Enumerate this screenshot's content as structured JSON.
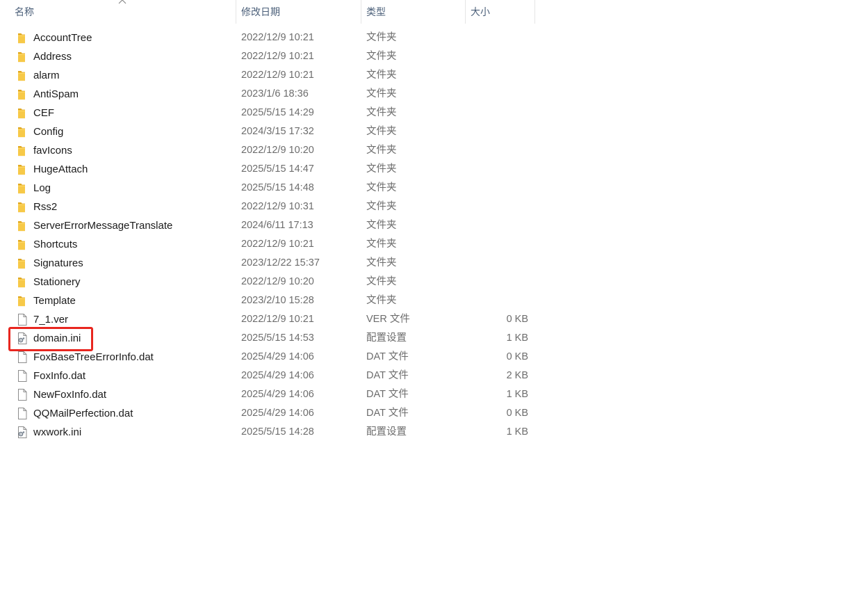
{
  "columns": {
    "name": "名称",
    "date": "修改日期",
    "type": "类型",
    "size": "大小"
  },
  "sort": {
    "column": "name",
    "direction": "ascending",
    "indicator_icon": "chevron-up-icon"
  },
  "colors": {
    "header_text": "#4c607a",
    "folder_yellow": "#f7c948",
    "highlight_red": "#e8261f"
  },
  "files": [
    {
      "name": "AccountTree",
      "date": "2022/12/9 10:21",
      "type": "文件夹",
      "size": "",
      "icon": "folder-icon"
    },
    {
      "name": "Address",
      "date": "2022/12/9 10:21",
      "type": "文件夹",
      "size": "",
      "icon": "folder-icon"
    },
    {
      "name": "alarm",
      "date": "2022/12/9 10:21",
      "type": "文件夹",
      "size": "",
      "icon": "folder-icon"
    },
    {
      "name": "AntiSpam",
      "date": "2023/1/6 18:36",
      "type": "文件夹",
      "size": "",
      "icon": "folder-icon"
    },
    {
      "name": "CEF",
      "date": "2025/5/15 14:29",
      "type": "文件夹",
      "size": "",
      "icon": "folder-icon"
    },
    {
      "name": "Config",
      "date": "2024/3/15 17:32",
      "type": "文件夹",
      "size": "",
      "icon": "folder-icon"
    },
    {
      "name": "favIcons",
      "date": "2022/12/9 10:20",
      "type": "文件夹",
      "size": "",
      "icon": "folder-icon"
    },
    {
      "name": "HugeAttach",
      "date": "2025/5/15 14:47",
      "type": "文件夹",
      "size": "",
      "icon": "folder-icon"
    },
    {
      "name": "Log",
      "date": "2025/5/15 14:48",
      "type": "文件夹",
      "size": "",
      "icon": "folder-icon"
    },
    {
      "name": "Rss2",
      "date": "2022/12/9 10:31",
      "type": "文件夹",
      "size": "",
      "icon": "folder-icon"
    },
    {
      "name": "ServerErrorMessageTranslate",
      "date": "2024/6/11 17:13",
      "type": "文件夹",
      "size": "",
      "icon": "folder-icon"
    },
    {
      "name": "Shortcuts",
      "date": "2022/12/9 10:21",
      "type": "文件夹",
      "size": "",
      "icon": "folder-icon"
    },
    {
      "name": "Signatures",
      "date": "2023/12/22 15:37",
      "type": "文件夹",
      "size": "",
      "icon": "folder-icon"
    },
    {
      "name": "Stationery",
      "date": "2022/12/9 10:20",
      "type": "文件夹",
      "size": "",
      "icon": "folder-icon"
    },
    {
      "name": "Template",
      "date": "2023/2/10 15:28",
      "type": "文件夹",
      "size": "",
      "icon": "folder-icon"
    },
    {
      "name": "7_1.ver",
      "date": "2022/12/9 10:21",
      "type": "VER 文件",
      "size": "0 KB",
      "icon": "file-icon"
    },
    {
      "name": "domain.ini",
      "date": "2025/5/15 14:53",
      "type": "配置设置",
      "size": "1 KB",
      "icon": "config-file-icon",
      "highlighted": true
    },
    {
      "name": "FoxBaseTreeErrorInfo.dat",
      "date": "2025/4/29 14:06",
      "type": "DAT 文件",
      "size": "0 KB",
      "icon": "file-icon"
    },
    {
      "name": "FoxInfo.dat",
      "date": "2025/4/29 14:06",
      "type": "DAT 文件",
      "size": "2 KB",
      "icon": "file-icon"
    },
    {
      "name": "NewFoxInfo.dat",
      "date": "2025/4/29 14:06",
      "type": "DAT 文件",
      "size": "1 KB",
      "icon": "file-icon"
    },
    {
      "name": "QQMailPerfection.dat",
      "date": "2025/4/29 14:06",
      "type": "DAT 文件",
      "size": "0 KB",
      "icon": "file-icon"
    },
    {
      "name": "wxwork.ini",
      "date": "2025/5/15 14:28",
      "type": "配置设置",
      "size": "1 KB",
      "icon": "config-file-icon"
    }
  ]
}
